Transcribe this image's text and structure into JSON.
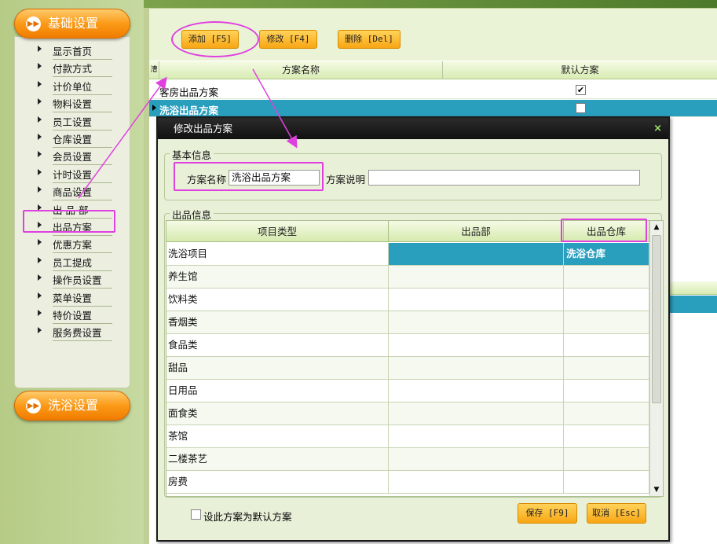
{
  "sidebar": {
    "category_basic": "基础设置",
    "category_bath": "洗浴设置",
    "category_icon": "chevron-right-icon",
    "items": [
      {
        "label": "显示首页"
      },
      {
        "label": "付款方式"
      },
      {
        "label": "计价单位"
      },
      {
        "label": "物料设置"
      },
      {
        "label": "员工设置"
      },
      {
        "label": "仓库设置"
      },
      {
        "label": "会员设置"
      },
      {
        "label": "计时设置"
      },
      {
        "label": "商品设置"
      },
      {
        "label": "出 品 部"
      },
      {
        "label": "出品方案"
      },
      {
        "label": "优惠方案"
      },
      {
        "label": "员工提成"
      },
      {
        "label": "操作员设置"
      },
      {
        "label": "菜单设置"
      },
      {
        "label": "特价设置"
      },
      {
        "label": "服务费设置"
      }
    ]
  },
  "toolbar": {
    "add_label": "添加 [F5]",
    "edit_label": "修改 [F4]",
    "delete_label": "删除 [Del]"
  },
  "grid": {
    "col_row_indicator": "漕",
    "col_name": "方案名称",
    "col_default": "默认方案",
    "rows": [
      {
        "name": "客房出品方案",
        "default": "✔"
      },
      {
        "name": "洗浴出品方案",
        "default": ""
      }
    ]
  },
  "dialog": {
    "title": "修改出品方案",
    "close": "×",
    "basic_info_label": "基本信息",
    "name_label": "方案名称",
    "name_value": "洗浴出品方案",
    "desc_label": "方案说明",
    "desc_value": "",
    "output_info_label": "出品信息",
    "table": {
      "headers": [
        "项目类型",
        "出品部",
        "出品仓库"
      ],
      "rows": [
        {
          "type": "洗浴项目",
          "dept": "",
          "store": "洗浴仓库"
        },
        {
          "type": "养生馆",
          "dept": "",
          "store": ""
        },
        {
          "type": "饮料类",
          "dept": "",
          "store": ""
        },
        {
          "type": "香烟类",
          "dept": "",
          "store": ""
        },
        {
          "type": "食品类",
          "dept": "",
          "store": ""
        },
        {
          "type": "甜品",
          "dept": "",
          "store": ""
        },
        {
          "type": "日用品",
          "dept": "",
          "store": ""
        },
        {
          "type": "面食类",
          "dept": "",
          "store": ""
        },
        {
          "type": "茶馆",
          "dept": "",
          "store": ""
        },
        {
          "type": "二楼茶艺",
          "dept": "",
          "store": ""
        },
        {
          "type": "房费",
          "dept": "",
          "store": ""
        }
      ]
    },
    "default_checkbox_label": "设此方案为默认方案",
    "save_label": "保存 [F9]",
    "cancel_label": "取消 [Esc]"
  },
  "colors": {
    "accent_orange": "#f89a18",
    "selection_blue": "#2a9ebd",
    "annotation_magenta": "#e040e0"
  }
}
